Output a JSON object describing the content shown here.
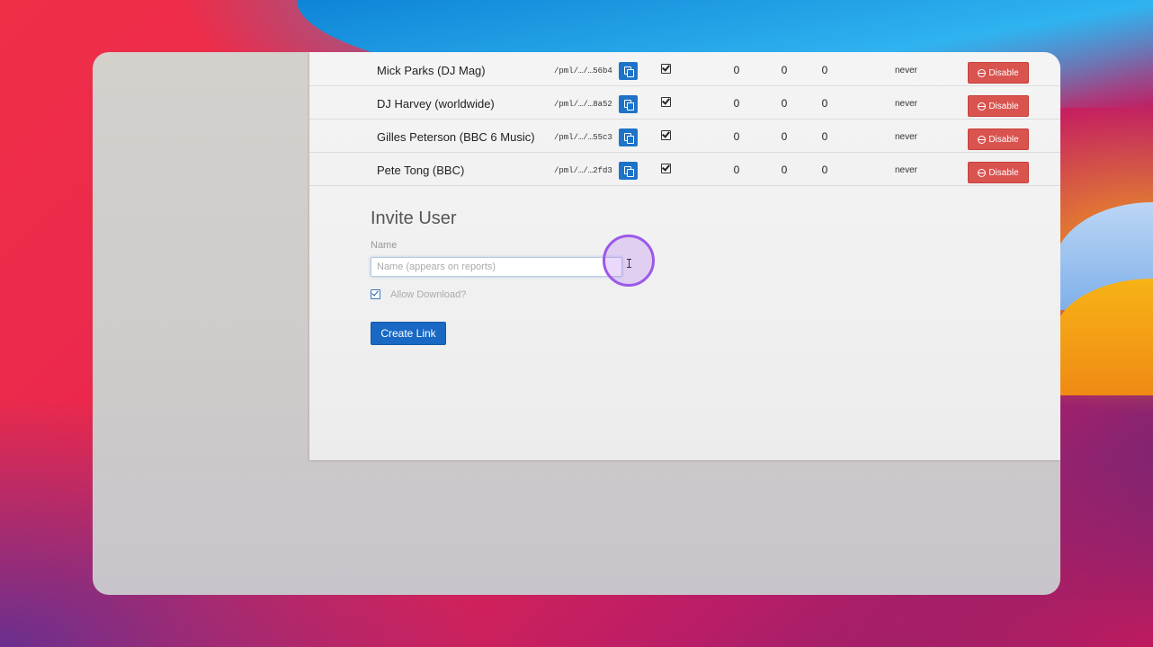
{
  "users": [
    {
      "name": "Mick Parks (DJ Mag)",
      "path": "/pml/…/…56b4",
      "allow_download": true,
      "c1": "0",
      "c2": "0",
      "c3": "0",
      "last": "never",
      "action": "Disable"
    },
    {
      "name": "DJ Harvey (worldwide)",
      "path": "/pml/…/…8a52",
      "allow_download": true,
      "c1": "0",
      "c2": "0",
      "c3": "0",
      "last": "never",
      "action": "Disable"
    },
    {
      "name": "Gilles Peterson (BBC 6 Music)",
      "path": "/pml/…/…55c3",
      "allow_download": true,
      "c1": "0",
      "c2": "0",
      "c3": "0",
      "last": "never",
      "action": "Disable"
    },
    {
      "name": "Pete Tong (BBC)",
      "path": "/pml/…/…2fd3",
      "allow_download": true,
      "c1": "0",
      "c2": "0",
      "c3": "0",
      "last": "never",
      "action": "Disable"
    }
  ],
  "invite": {
    "title": "Invite User",
    "name_label": "Name",
    "name_placeholder": "Name (appears on reports)",
    "name_value": "",
    "allow_download_label": "Allow Download?",
    "allow_download_checked": true,
    "create_button": "Create Link"
  },
  "icons": {
    "copy": "copy-icon",
    "check": "checkbox-checked-icon",
    "disable": "ban-icon",
    "cursor": "text-cursor-icon"
  },
  "colors": {
    "primary_button": "#1868c4",
    "danger_button": "#d9534f"
  }
}
